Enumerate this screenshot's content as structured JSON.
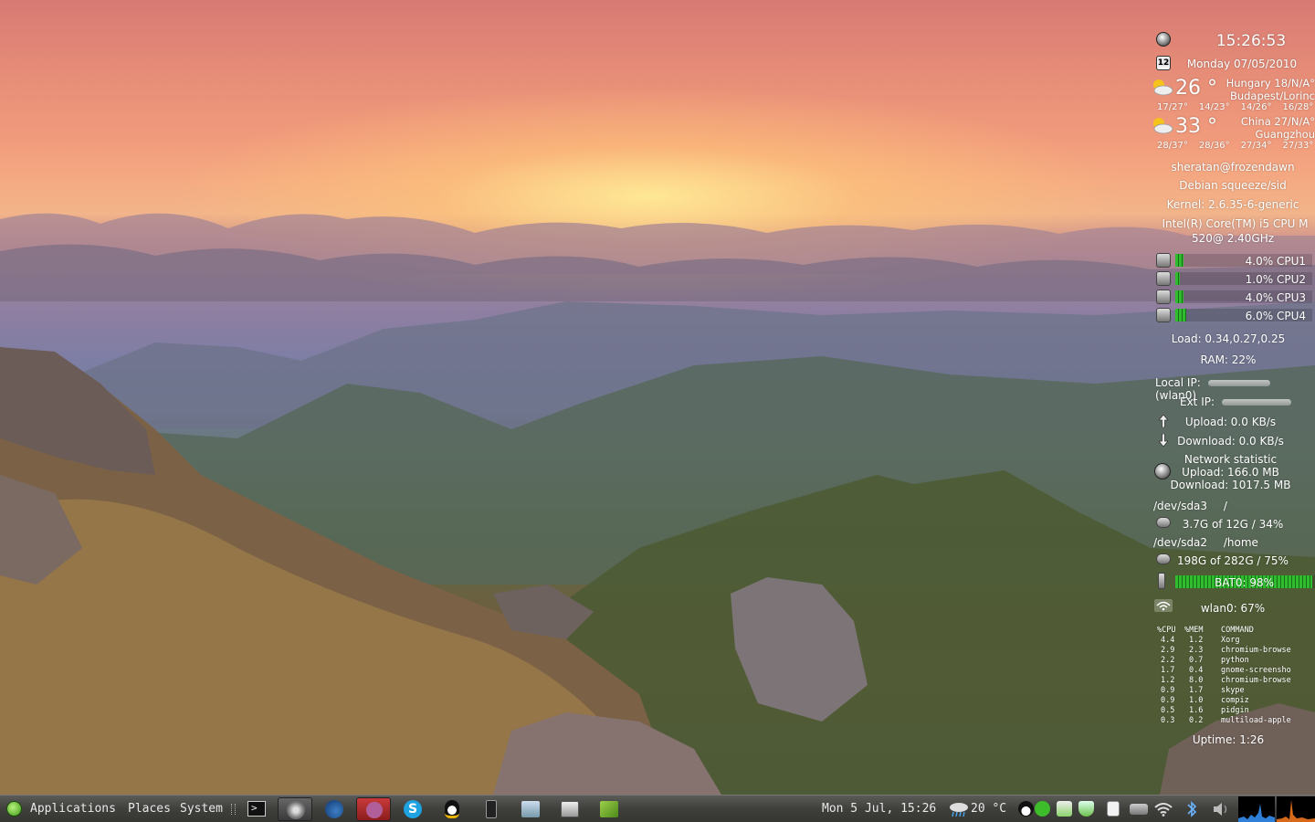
{
  "conky": {
    "time": "15:26:53",
    "date_icon": "12",
    "date": "Monday 07/05/2010",
    "weather": [
      {
        "temp": "26 °",
        "location": "Hungary 18/N/A°",
        "city": "Budapest/Lorinc",
        "forecast": [
          "17/27°",
          "14/23°",
          "14/26°",
          "16/28°"
        ]
      },
      {
        "temp": "33 °",
        "location": "China 27/N/A°",
        "city": "Guangzhou",
        "forecast": [
          "28/37°",
          "28/36°",
          "27/34°",
          "27/33°"
        ]
      }
    ],
    "user": "sheratan@frozendawn",
    "distro": "Debian squeeze/sid",
    "kernel": "Kernel: 2.6.35-6-generic",
    "cpu_model_1": "Intel(R) Core(TM) i5 CPU M",
    "cpu_model_2": "520@ 2.40GHz",
    "cpus": [
      {
        "label": "4.0% CPU1",
        "level": 0.04
      },
      {
        "label": "1.0% CPU2",
        "level": 0.01
      },
      {
        "label": "4.0% CPU3",
        "level": 0.04
      },
      {
        "label": "6.0% CPU4",
        "level": 0.06
      }
    ],
    "load": "Load: 0.34,0.27,0.25",
    "ram": "RAM: 22%",
    "local_ip_label": "Local IP:",
    "local_ip_iface": "(wlan0)",
    "ext_ip_label": "Ext IP:",
    "upload": "Upload: 0.0 KB/s",
    "download": "Download: 0.0 KB/s",
    "net_title": "Network statistic",
    "net_upload": "Upload: 166.0 MB",
    "net_download": "Download: 1017.5 MB",
    "disk1_dev": "/dev/sda3",
    "disk1_mount": "/",
    "disk1_usage": "3.7G of 12G / 34%",
    "disk2_dev": "/dev/sda2",
    "disk2_mount": "/home",
    "disk2_usage": "198G of 282G / 75%",
    "battery": "BAT0: 98%",
    "battery_level": 0.98,
    "wifi": "wlan0: 67%",
    "top_header": {
      "cpu": "%CPU",
      "mem": "%MEM",
      "cmd": "COMMAND"
    },
    "top": [
      {
        "cpu": "4.4",
        "mem": "1.2",
        "cmd": "Xorg"
      },
      {
        "cpu": "2.9",
        "mem": "2.3",
        "cmd": "chromium-browse"
      },
      {
        "cpu": "2.2",
        "mem": "0.7",
        "cmd": "python"
      },
      {
        "cpu": "1.7",
        "mem": "0.4",
        "cmd": "gnome-screensho"
      },
      {
        "cpu": "1.2",
        "mem": "8.0",
        "cmd": "chromium-browse"
      },
      {
        "cpu": "0.9",
        "mem": "1.7",
        "cmd": "skype"
      },
      {
        "cpu": "0.9",
        "mem": "1.0",
        "cmd": "compiz"
      },
      {
        "cpu": "0.5",
        "mem": "1.6",
        "cmd": "pidgin"
      },
      {
        "cpu": "0.3",
        "mem": "0.2",
        "cmd": "multiload-apple"
      }
    ],
    "uptime": "Uptime: 1:26"
  },
  "panel": {
    "menus": [
      "Applications",
      "Places",
      "System"
    ],
    "launchers": [
      "terminal-icon",
      "media-icon",
      "thunderbird-icon",
      "pidgin-icon",
      "skype-icon",
      "qq-icon",
      "speaker-icon",
      "video-player-icon",
      "screenshot-icon",
      "book-icon"
    ],
    "clock": "Mon  5 Jul, 15:26",
    "weather_temp": "20 °C"
  }
}
